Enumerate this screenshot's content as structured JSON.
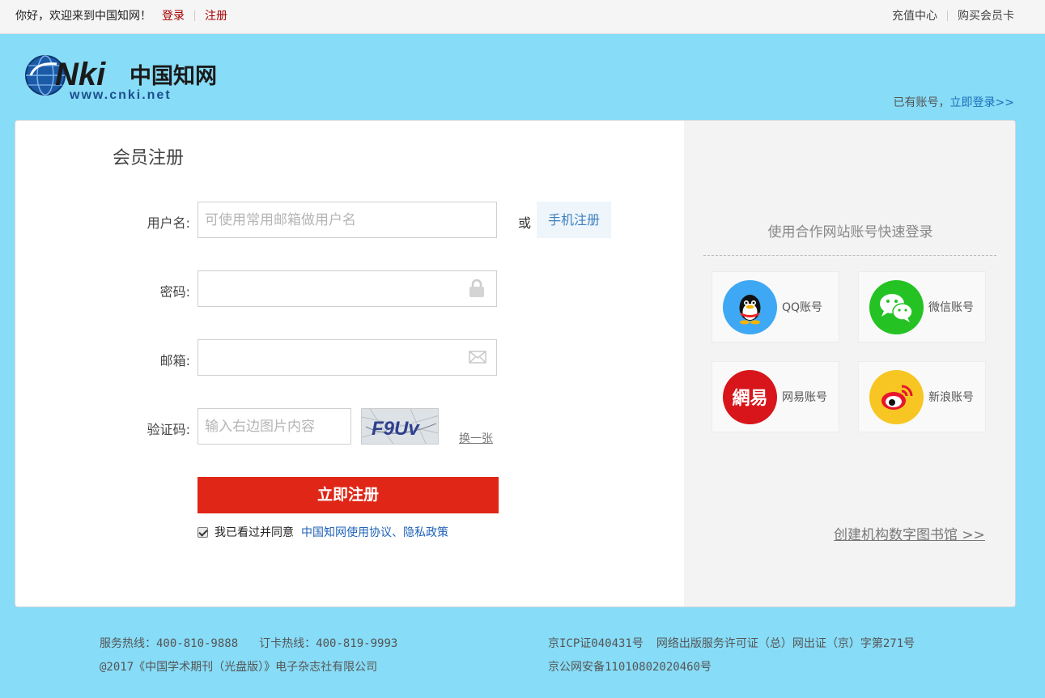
{
  "topbar": {
    "greeting": "你好，欢迎来到中国知网！",
    "login": "登录",
    "register": "注册",
    "recharge": "充值中心",
    "buy_card": "购买会员卡"
  },
  "header": {
    "logo_text": "CNKi",
    "logo_cn": "中国知网",
    "logo_url": "www.cnki.net",
    "have_account": "已有账号，",
    "login_now": "立即登录>>"
  },
  "form": {
    "title": "会员注册",
    "username_label": "用户名:",
    "username_placeholder": "可使用常用邮箱做用户名",
    "or": "或",
    "phone_register": "手机注册",
    "password_label": "密码:",
    "email_label": "邮箱:",
    "captcha_label": "验证码:",
    "captcha_placeholder": "输入右边图片内容",
    "captcha_text": "F9Uv",
    "swap": "换一张",
    "submit": "立即注册",
    "agree_text": "我已看过并同意",
    "agree_link": "中国知网使用协议、隐私政策"
  },
  "social": {
    "title": "使用合作网站账号快速登录",
    "items": [
      {
        "label": "QQ账号",
        "icon": "qq-icon",
        "color": "#3fa8f4"
      },
      {
        "label": "微信账号",
        "icon": "wechat-icon",
        "color": "#25c223"
      },
      {
        "label": "网易账号",
        "icon": "netease-icon",
        "color": "#d8151a"
      },
      {
        "label": "新浪账号",
        "icon": "weibo-icon",
        "color": "#f7c623"
      }
    ],
    "library": "创建机构数字图书馆 >>"
  },
  "footer": {
    "hotline": "服务热线：400-810-9888",
    "order_hotline": "订卡热线：400-819-9993",
    "copyright": "@2017《中国学术期刊（光盘版）》电子杂志社有限公司",
    "icp": "京ICP证040431号",
    "license": "网络出版服务许可证（总）网出证（京）字第271号",
    "police": "京公网安备11010802020460号"
  }
}
